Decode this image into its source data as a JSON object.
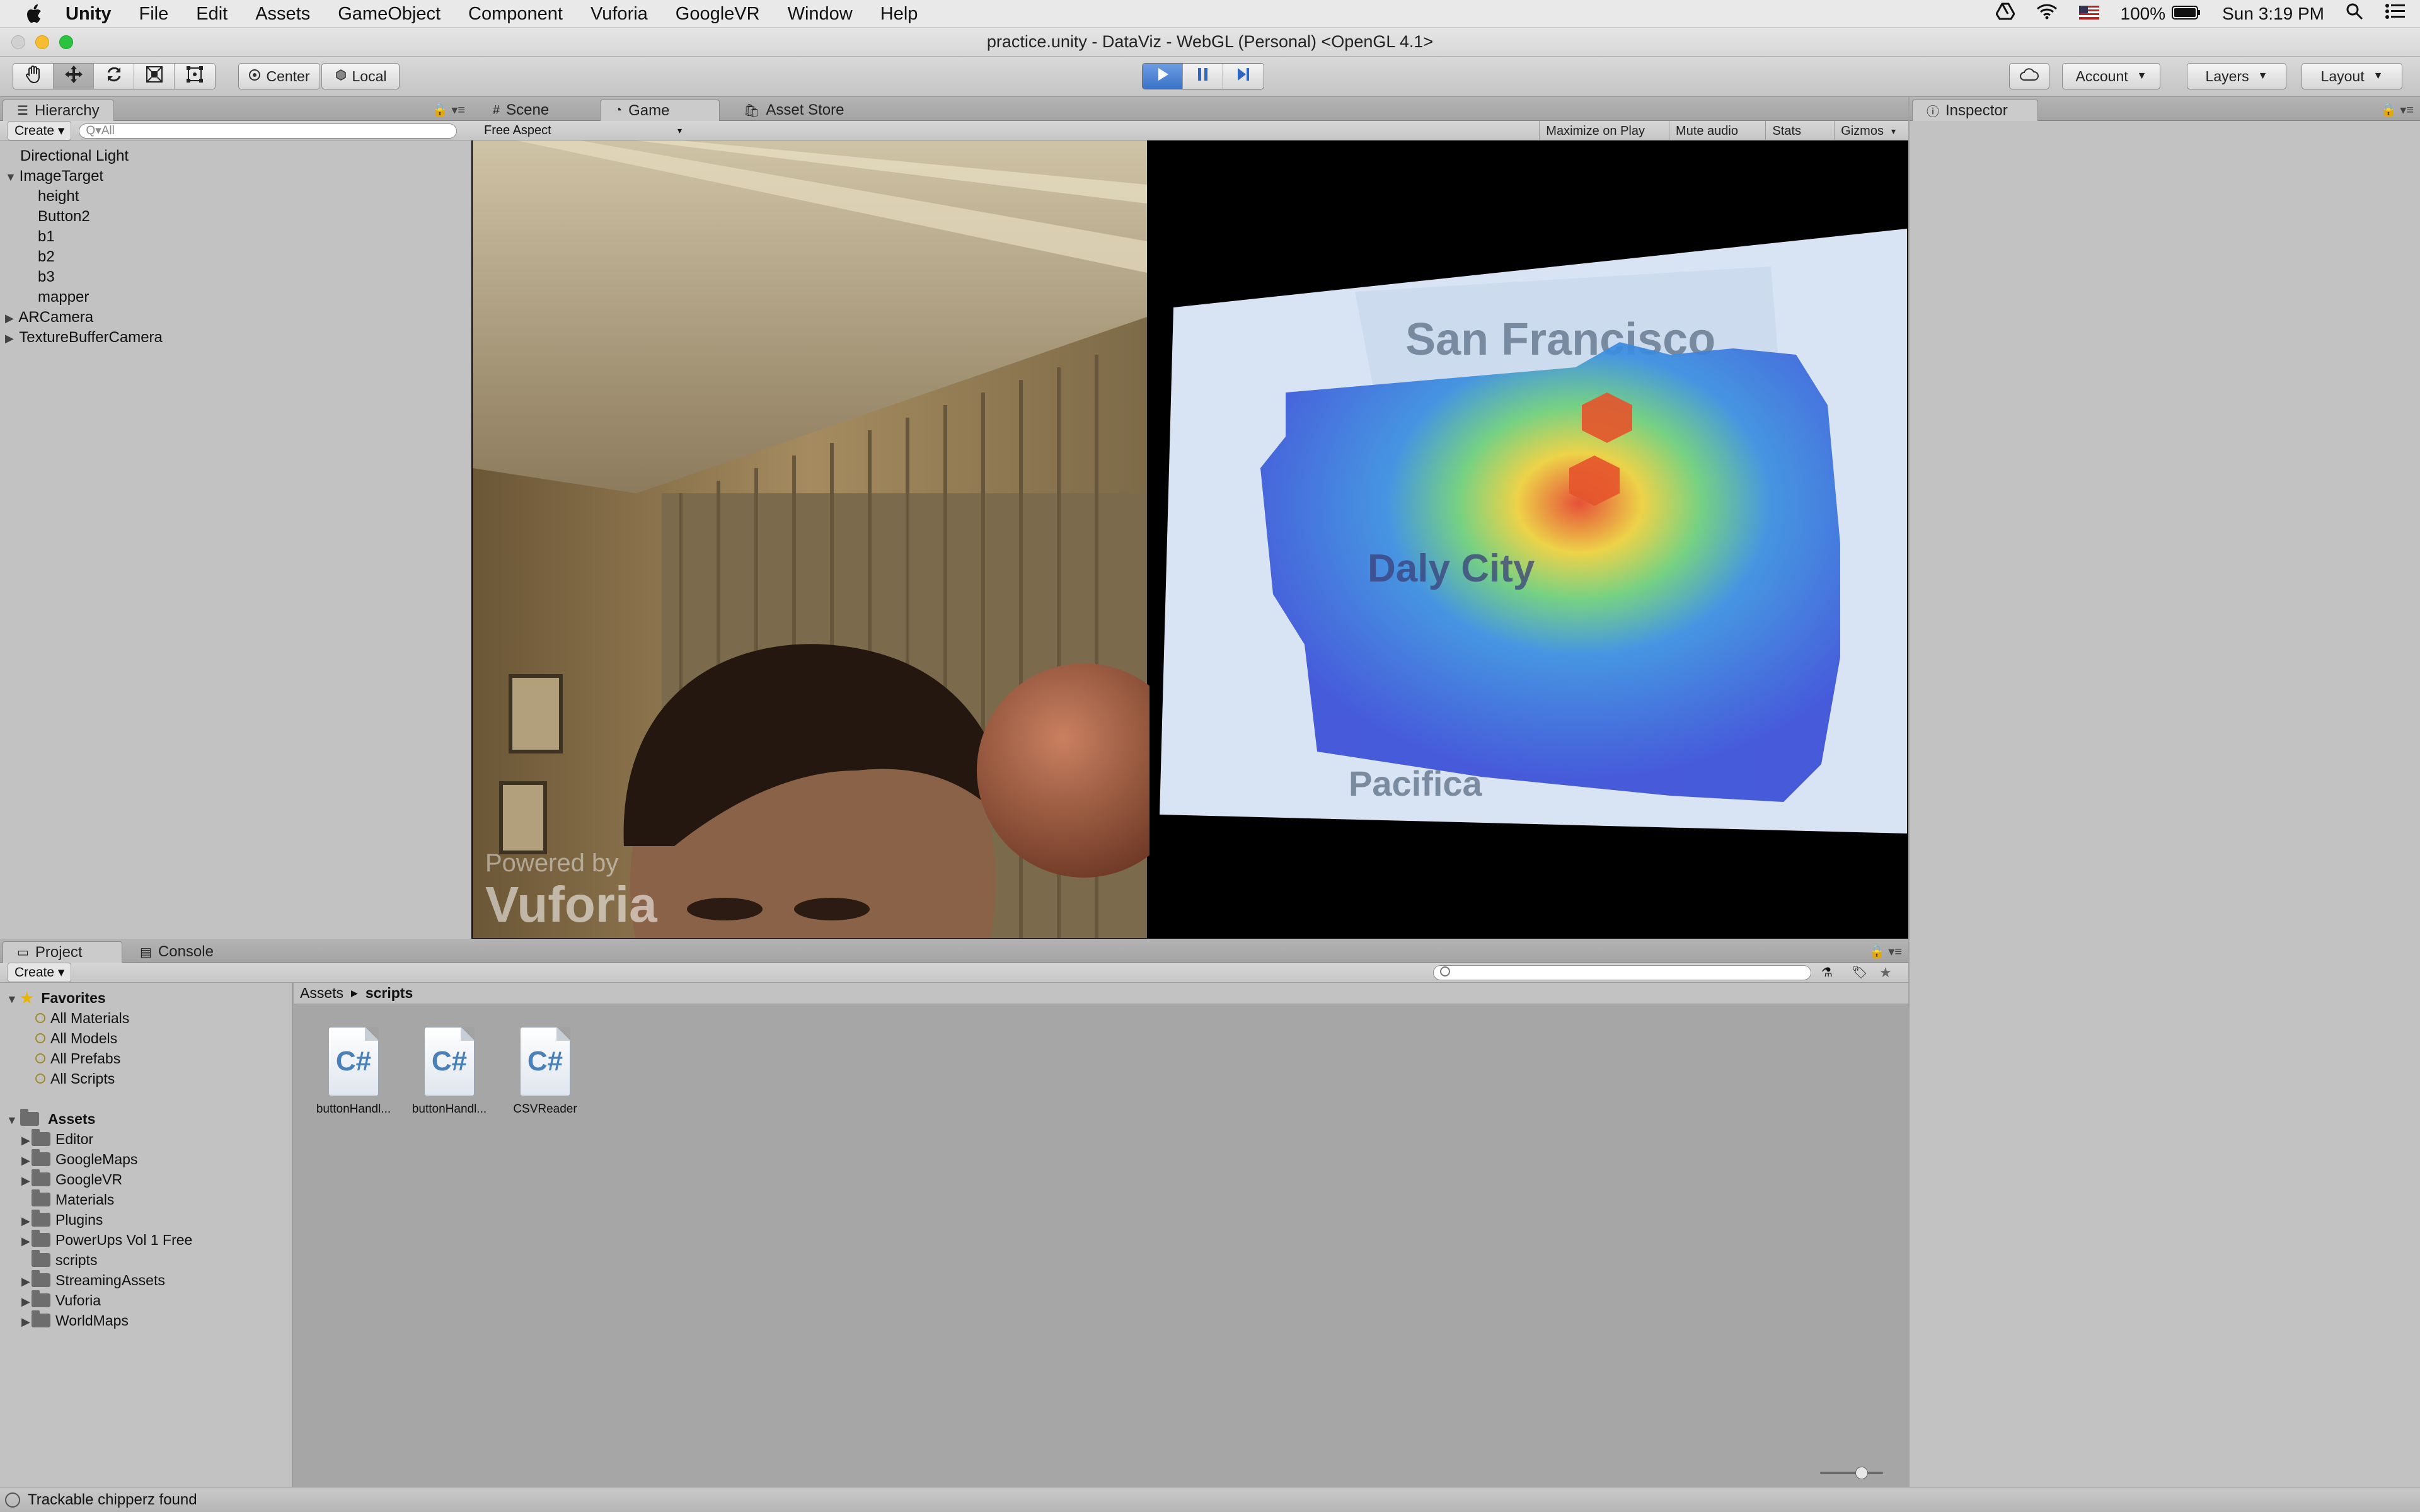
{
  "menubar": {
    "app_name": "Unity",
    "items": [
      "File",
      "Edit",
      "Assets",
      "GameObject",
      "Component",
      "Vuforia",
      "GoogleVR",
      "Window",
      "Help"
    ],
    "battery": "100%",
    "clock": "Sun 3:19 PM"
  },
  "window": {
    "title": "practice.unity - DataViz - WebGL (Personal) <OpenGL 4.1>"
  },
  "toolbar": {
    "pivot_label": "Center",
    "space_label": "Local",
    "account_label": "Account",
    "layers_label": "Layers",
    "layout_label": "Layout"
  },
  "hierarchy": {
    "tab_label": "Hierarchy",
    "create_label": "Create",
    "search_placeholder": "Q▾All",
    "items": [
      {
        "label": "Directional Light"
      },
      {
        "label": "ImageTarget"
      },
      {
        "label": "height"
      },
      {
        "label": "Button2"
      },
      {
        "label": "b1"
      },
      {
        "label": "b2"
      },
      {
        "label": "b3"
      },
      {
        "label": "mapper"
      },
      {
        "label": "ARCamera"
      },
      {
        "label": "TextureBufferCamera"
      }
    ]
  },
  "center_tabs": {
    "scene": "Scene",
    "game": "Game",
    "asset_store": "Asset Store"
  },
  "game_toolbar": {
    "aspect": "Free Aspect",
    "maximize": "Maximize on Play",
    "mute": "Mute audio",
    "stats": "Stats",
    "gizmos": "Gizmos"
  },
  "game_view": {
    "map_labels": [
      "San Francisco",
      "Daly City",
      "Pacifica"
    ],
    "watermark_top": "Powered by",
    "watermark_bottom": "Vuforia"
  },
  "inspector": {
    "tab_label": "Inspector"
  },
  "project": {
    "tab_project": "Project",
    "tab_console": "Console",
    "create_label": "Create",
    "favorites_label": "Favorites",
    "favorites": [
      "All Materials",
      "All Models",
      "All Prefabs",
      "All Scripts"
    ],
    "assets_label": "Assets",
    "folders": [
      "Editor",
      "GoogleMaps",
      "GoogleVR",
      "Materials",
      "Plugins",
      "PowerUps Vol 1 Free",
      "scripts",
      "StreamingAssets",
      "Vuforia",
      "WorldMaps"
    ],
    "breadcrumb_root": "Assets",
    "breadcrumb_current": "scripts",
    "files": [
      {
        "label": "buttonHandl..."
      },
      {
        "label": "buttonHandl..."
      },
      {
        "label": "CSVReader"
      }
    ]
  },
  "status": {
    "message": "Trackable chipperz found"
  }
}
